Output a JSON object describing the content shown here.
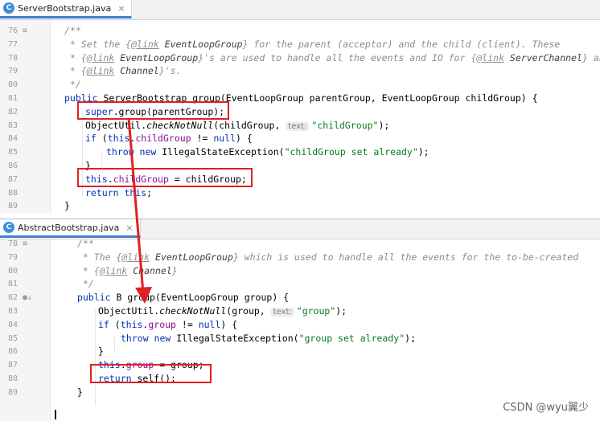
{
  "top_editor": {
    "tab_label": "ServerBootstrap.java",
    "tab_icon": "C",
    "close": "×",
    "lines": [
      {
        "n": "76",
        "segs": [
          [
            "c",
            "/**"
          ]
        ]
      },
      {
        "n": "77",
        "segs": [
          [
            "c",
            " * Set the {"
          ],
          [
            "d",
            "@link"
          ],
          [
            "r",
            " EventLoopGroup"
          ],
          [
            "c",
            "} for the parent (acceptor) and the child (client). These"
          ]
        ]
      },
      {
        "n": "78",
        "segs": [
          [
            "c",
            " * {"
          ],
          [
            "d",
            "@link"
          ],
          [
            "r",
            " EventLoopGroup"
          ],
          [
            "c",
            "}'s are used to handle all the events and IO for {"
          ],
          [
            "d",
            "@link"
          ],
          [
            "r",
            " ServerChannel"
          ],
          [
            "c",
            "} and"
          ]
        ]
      },
      {
        "n": "79",
        "segs": [
          [
            "c",
            " * {"
          ],
          [
            "d",
            "@link"
          ],
          [
            "r",
            " Channel"
          ],
          [
            "c",
            "}'s."
          ]
        ]
      },
      {
        "n": "80",
        "segs": [
          [
            "c",
            " */"
          ]
        ]
      },
      {
        "n": "81",
        "segs": [
          [
            "k",
            "public "
          ],
          [
            "p",
            "ServerBootstrap group(EventLoopGroup parentGroup, EventLoopGroup childGroup) {"
          ]
        ]
      },
      {
        "n": "82",
        "segs": [
          [
            "k",
            "super"
          ],
          [
            "p",
            ".group(parentGroup);"
          ]
        ]
      },
      {
        "n": "83",
        "segs": [
          [
            "p",
            "ObjectUtil."
          ],
          [
            "i",
            "checkNotNull"
          ],
          [
            "p",
            "(childGroup, "
          ],
          [
            "h",
            "text:"
          ],
          [
            "s",
            "\"childGroup\""
          ],
          [
            "p",
            ");"
          ]
        ]
      },
      {
        "n": "84",
        "segs": [
          [
            "k",
            "if "
          ],
          [
            "p",
            "("
          ],
          [
            "k",
            "this"
          ],
          [
            "p",
            "."
          ],
          [
            "f",
            "childGroup"
          ],
          [
            "p",
            " != "
          ],
          [
            "k",
            "null"
          ],
          [
            "p",
            ") {"
          ]
        ]
      },
      {
        "n": "85",
        "segs": [
          [
            "k",
            "throw new "
          ],
          [
            "p",
            "IllegalStateException("
          ],
          [
            "s",
            "\"childGroup set already\""
          ],
          [
            "p",
            ");"
          ]
        ]
      },
      {
        "n": "86",
        "segs": [
          [
            "p",
            "}"
          ]
        ]
      },
      {
        "n": "87",
        "segs": [
          [
            "k",
            "this"
          ],
          [
            "p",
            "."
          ],
          [
            "f",
            "childGroup"
          ],
          [
            "p",
            " = childGroup;"
          ]
        ]
      },
      {
        "n": "88",
        "segs": [
          [
            "k",
            "return this"
          ],
          [
            "p",
            ";"
          ]
        ]
      },
      {
        "n": "89",
        "segs": [
          [
            "p",
            "}"
          ]
        ]
      }
    ]
  },
  "bottom_editor": {
    "tab_label": "AbstractBootstrap.java",
    "tab_icon": "C",
    "close": "×",
    "lines": [
      {
        "n": "78",
        "segs": [
          [
            "c",
            "/**"
          ]
        ]
      },
      {
        "n": "79",
        "segs": [
          [
            "c",
            " * The {"
          ],
          [
            "d",
            "@link"
          ],
          [
            "r",
            " EventLoopGroup"
          ],
          [
            "c",
            "} which is used to handle all the events for the to-be-created"
          ]
        ]
      },
      {
        "n": "80",
        "segs": [
          [
            "c",
            " * {"
          ],
          [
            "d",
            "@link"
          ],
          [
            "r",
            " Channel"
          ],
          [
            "c",
            "}"
          ]
        ]
      },
      {
        "n": "81",
        "segs": [
          [
            "c",
            " */"
          ]
        ]
      },
      {
        "n": "82",
        "segs": [
          [
            "k",
            "public "
          ],
          [
            "p",
            "B group(EventLoopGroup group) {"
          ]
        ]
      },
      {
        "n": "83",
        "segs": [
          [
            "p",
            "ObjectUtil."
          ],
          [
            "i",
            "checkNotNull"
          ],
          [
            "p",
            "(group, "
          ],
          [
            "h",
            "text:"
          ],
          [
            "s",
            "\"group\""
          ],
          [
            "p",
            ");"
          ]
        ]
      },
      {
        "n": "84",
        "segs": [
          [
            "k",
            "if "
          ],
          [
            "p",
            "("
          ],
          [
            "k",
            "this"
          ],
          [
            "p",
            "."
          ],
          [
            "f",
            "group"
          ],
          [
            "p",
            " != "
          ],
          [
            "k",
            "null"
          ],
          [
            "p",
            ") {"
          ]
        ]
      },
      {
        "n": "85",
        "segs": [
          [
            "k",
            "throw new "
          ],
          [
            "p",
            "IllegalStateException("
          ],
          [
            "s",
            "\"group set already\""
          ],
          [
            "p",
            ");"
          ]
        ]
      },
      {
        "n": "86",
        "segs": [
          [
            "p",
            "}"
          ]
        ]
      },
      {
        "n": "87",
        "segs": [
          [
            "k",
            "this"
          ],
          [
            "p",
            "."
          ],
          [
            "f",
            "group"
          ],
          [
            "p",
            " = group;"
          ]
        ]
      },
      {
        "n": "88",
        "segs": [
          [
            "k",
            "return "
          ],
          [
            "p",
            "self();"
          ]
        ]
      },
      {
        "n": "89",
        "segs": [
          [
            "p",
            "}"
          ]
        ]
      }
    ]
  },
  "watermark": "CSDN @wyu翼少",
  "colors": {
    "keyword": "#0033b3",
    "field": "#871094",
    "string": "#067d17",
    "comment": "#8c8c8c",
    "highlight_box": "#e02020",
    "arrow": "#e02020"
  }
}
